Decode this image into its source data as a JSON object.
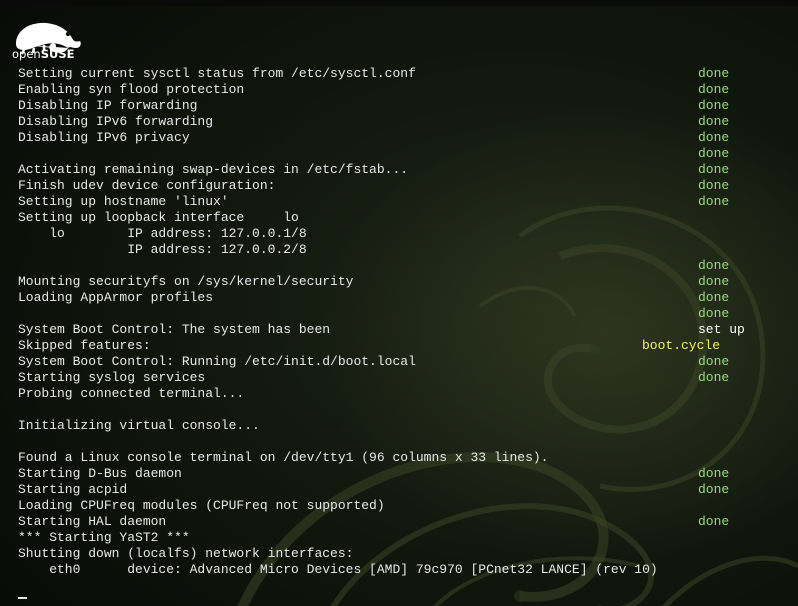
{
  "branding": {
    "logo_icon": "opensuse-chameleon-icon",
    "logo_light": "open",
    "logo_bold": "SUSE"
  },
  "colors": {
    "text": "#e8e8e8",
    "done": "#8ee07a",
    "skipped": "#f4f06a",
    "setup": "#ffffff"
  },
  "lines": [
    {
      "text": "Setting current sysctl status from /etc/sysctl.conf",
      "status": "done"
    },
    {
      "text": "Enabling syn flood protection",
      "status": "done"
    },
    {
      "text": "Disabling IP forwarding",
      "status": "done"
    },
    {
      "text": "Disabling IPv6 forwarding",
      "status": "done"
    },
    {
      "text": "Disabling IPv6 privacy",
      "status": "done"
    },
    {
      "text": "",
      "status": "done"
    },
    {
      "text": "Activating remaining swap-devices in /etc/fstab...",
      "status": "done"
    },
    {
      "text": "Finish udev device configuration:",
      "status": "done"
    },
    {
      "text": "Setting up hostname 'linux'",
      "status": "done"
    },
    {
      "text": "Setting up loopback interface     lo",
      "status": ""
    },
    {
      "text": "    lo        IP address: 127.0.0.1/8",
      "status": ""
    },
    {
      "text": "              IP address: 127.0.0.2/8",
      "status": ""
    },
    {
      "text": "",
      "status": "done"
    },
    {
      "text": "Mounting securityfs on /sys/kernel/security",
      "status": "done"
    },
    {
      "text": "Loading AppArmor profiles",
      "status": "done"
    },
    {
      "text": "",
      "status": "done"
    },
    {
      "text": "System Boot Control: The system has been",
      "status": "set up"
    },
    {
      "text": "Skipped features:",
      "status": "boot.cycle"
    },
    {
      "text": "System Boot Control: Running /etc/init.d/boot.local",
      "status": "done"
    },
    {
      "text": "Starting syslog services",
      "status": "done"
    },
    {
      "text": "Probing connected terminal...",
      "status": ""
    },
    {
      "text": "",
      "status": ""
    },
    {
      "text": "Initializing virtual console...",
      "status": ""
    },
    {
      "text": "",
      "status": ""
    },
    {
      "text": "Found a Linux console terminal on /dev/tty1 (96 columns x 33 lines).",
      "status": ""
    },
    {
      "text": "Starting D-Bus daemon",
      "status": "done"
    },
    {
      "text": "Starting acpid",
      "status": "done"
    },
    {
      "text": "Loading CPUFreq modules (CPUFreq not supported)",
      "status": ""
    },
    {
      "text": "Starting HAL daemon",
      "status": "done"
    },
    {
      "text": "*** Starting YaST2 ***",
      "status": ""
    },
    {
      "text": "Shutting down (localfs) network interfaces:",
      "status": ""
    },
    {
      "text": "    eth0      device: Advanced Micro Devices [AMD] 79c970 [PCnet32 LANCE] (rev 10)",
      "status": ""
    }
  ],
  "cursor": "_"
}
